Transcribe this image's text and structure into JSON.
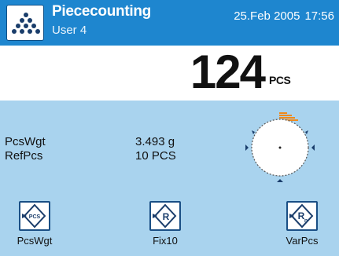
{
  "header": {
    "icon": "piececounting-dots-icon",
    "title": "Piececounting",
    "user": "User 4",
    "date": "25.Feb 2005",
    "time": "17:56"
  },
  "display": {
    "value": "124",
    "unit": "PCS"
  },
  "info": [
    {
      "label": "PcsWgt",
      "value": "3.493 g"
    },
    {
      "label": "RefPcs",
      "value": "10 PCS"
    }
  ],
  "dial": {
    "type": "circular weighing-in aid",
    "fill_fraction": 0.08
  },
  "softkeys": [
    {
      "label": "PcsWgt",
      "icon": "pcs-diamond-icon"
    },
    {
      "label": "Fix10",
      "icon": "r-diamond-icon"
    },
    {
      "label": "VarPcs",
      "icon": "rn-diamond-icon"
    }
  ],
  "colors": {
    "header_bg": "#1e86cf",
    "panel_bg": "#a9d3ee",
    "accent_orange": "#f08a1c",
    "key_border": "#1a4f85"
  }
}
